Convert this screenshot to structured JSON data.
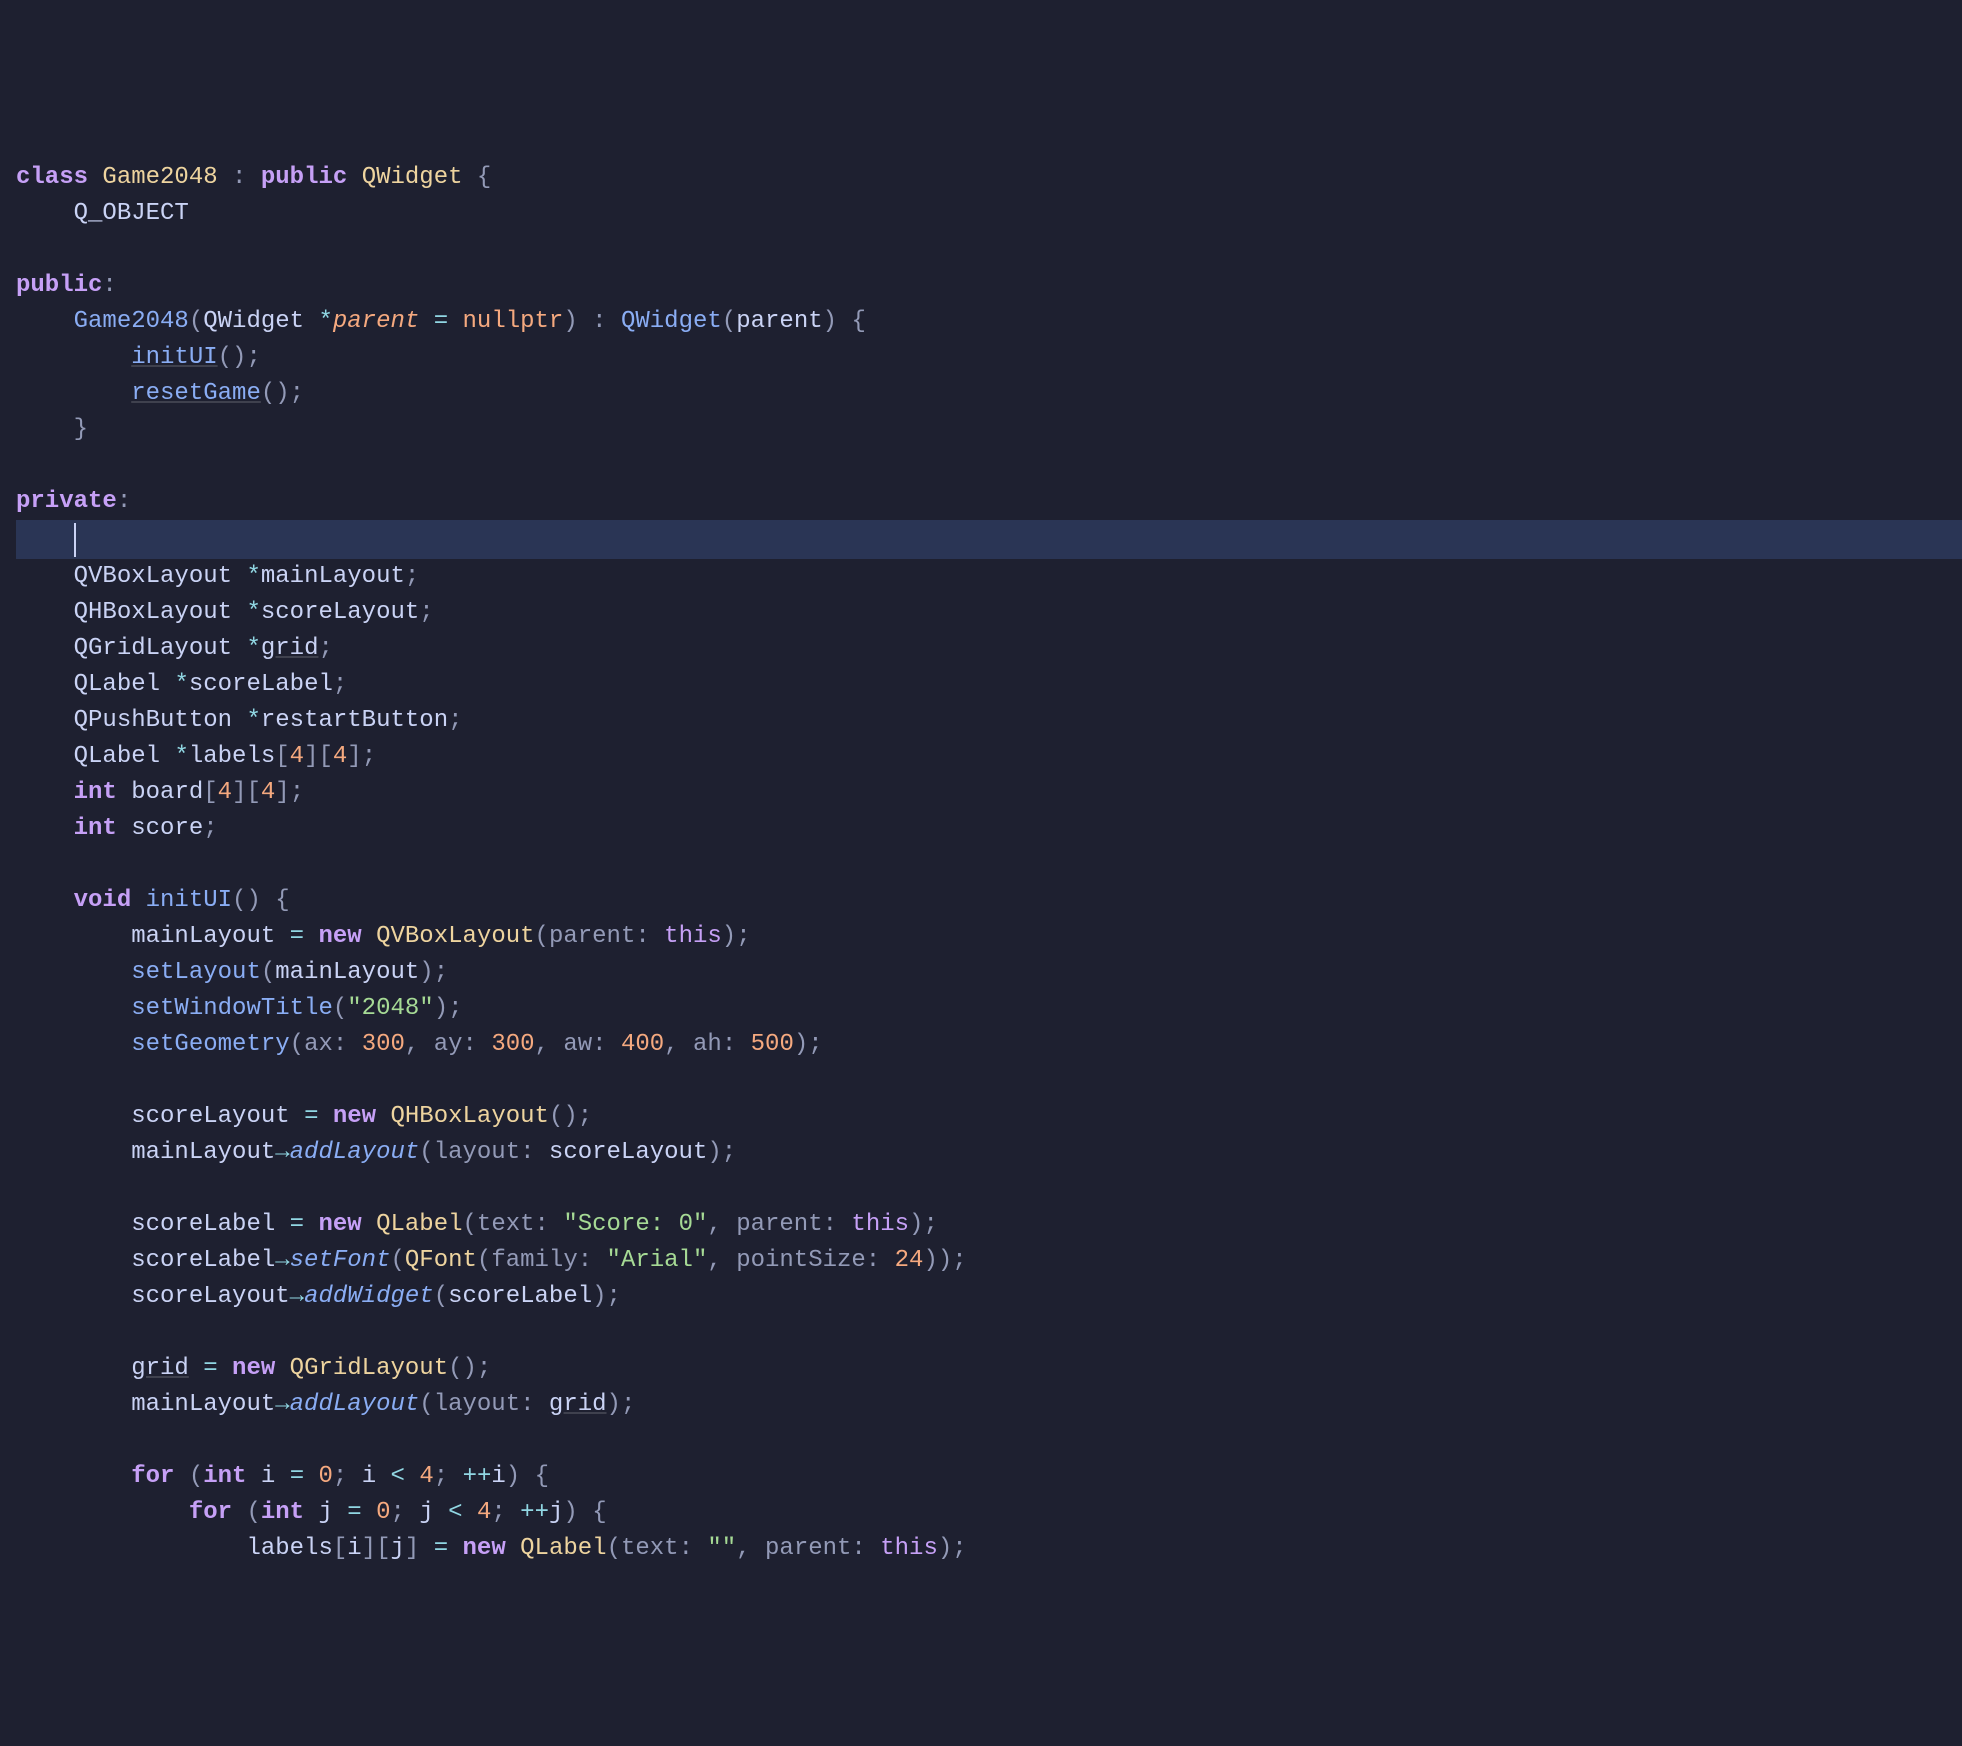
{
  "code": {
    "line1": {
      "kw_class": "class",
      "type_game": "Game2048",
      "colon": ":",
      "kw_public": "public",
      "type_qwidget": "QWidget",
      "brace": "{"
    },
    "line2": {
      "macro": "Q_OBJECT"
    },
    "line3": {
      "kw_public": "public",
      "colon": ":"
    },
    "line4": {
      "fn_game": "Game2048",
      "lparen": "(",
      "type_qwidget": "QWidget",
      "star": "*",
      "param_parent": "parent",
      "eq": "=",
      "kw_nullptr": "nullptr",
      "rparen": ")",
      "colon": ":",
      "fn_qwidget": "QWidget",
      "lparen2": "(",
      "var_parent": "parent",
      "rparen2": ")",
      "brace": "{"
    },
    "line5": {
      "fn_initui": "initUI",
      "parens": "()",
      "semi": ";"
    },
    "line6": {
      "fn_reset": "resetGame",
      "parens": "()",
      "semi": ";"
    },
    "line7": {
      "brace": "}"
    },
    "line8": {
      "kw_private": "private",
      "colon": ":"
    },
    "line10": {
      "type": "QVBoxLayout",
      "star": "*",
      "var": "mainLayout",
      "semi": ";"
    },
    "line11": {
      "type": "QHBoxLayout",
      "star": "*",
      "var": "scoreLayout",
      "semi": ";"
    },
    "line12": {
      "type": "QGridLayout",
      "star": "*",
      "var": "grid",
      "semi": ";"
    },
    "line13": {
      "type": "QLabel",
      "star": "*",
      "var": "scoreLabel",
      "semi": ";"
    },
    "line14": {
      "type": "QPushButton",
      "star": "*",
      "var": "restartButton",
      "semi": ";"
    },
    "line15": {
      "type": "QLabel",
      "star": "*",
      "var": "labels",
      "lb1": "[",
      "n1": "4",
      "rb1": "]",
      "lb2": "[",
      "n2": "4",
      "rb2": "]",
      "semi": ";"
    },
    "line16": {
      "kw_int": "int",
      "var": "board",
      "lb1": "[",
      "n1": "4",
      "rb1": "]",
      "lb2": "[",
      "n2": "4",
      "rb2": "]",
      "semi": ";"
    },
    "line17": {
      "kw_int": "int",
      "var": "score",
      "semi": ";"
    },
    "line18": {
      "kw_void": "void",
      "fn": "initUI",
      "parens": "()",
      "brace": "{"
    },
    "line19": {
      "var": "mainLayout",
      "eq": "=",
      "kw_new": "new",
      "type": "QVBoxLayout",
      "lparen": "(",
      "hint": "parent:",
      "kw_this": "this",
      "rparen": ")",
      "semi": ";"
    },
    "line20": {
      "fn": "setLayout",
      "lparen": "(",
      "var": "mainLayout",
      "rparen": ")",
      "semi": ";"
    },
    "line21": {
      "fn": "setWindowTitle",
      "lparen": "(",
      "str": "\"2048\"",
      "rparen": ")",
      "semi": ";"
    },
    "line22": {
      "fn": "setGeometry",
      "lparen": "(",
      "h1": "ax:",
      "n1": "300",
      "c1": ",",
      "h2": "ay:",
      "n2": "300",
      "c2": ",",
      "h3": "aw:",
      "n3": "400",
      "c3": ",",
      "h4": "ah:",
      "n4": "500",
      "rparen": ")",
      "semi": ";"
    },
    "line23": {
      "var": "scoreLayout",
      "eq": "=",
      "kw_new": "new",
      "type": "QHBoxLayout",
      "parens": "()",
      "semi": ";"
    },
    "line24": {
      "var": "mainLayout",
      "arrow": "→",
      "fn": "addLayout",
      "lparen": "(",
      "hint": "layout:",
      "var2": "scoreLayout",
      "rparen": ")",
      "semi": ";"
    },
    "line25": {
      "var": "scoreLabel",
      "eq": "=",
      "kw_new": "new",
      "type": "QLabel",
      "lparen": "(",
      "h1": "text:",
      "str": "\"Score: 0\"",
      "c1": ",",
      "h2": "parent:",
      "kw_this": "this",
      "rparen": ")",
      "semi": ";"
    },
    "line26": {
      "var": "scoreLabel",
      "arrow": "→",
      "fn": "setFont",
      "lparen": "(",
      "type": "QFont",
      "lparen2": "(",
      "h1": "family:",
      "str": "\"Arial\"",
      "c1": ",",
      "h2": "pointSize:",
      "n1": "24",
      "rparen2": ")",
      "rparen": ")",
      "semi": ";"
    },
    "line27": {
      "var": "scoreLayout",
      "arrow": "→",
      "fn": "addWidget",
      "lparen": "(",
      "var2": "scoreLabel",
      "rparen": ")",
      "semi": ";"
    },
    "line28": {
      "var": "grid",
      "eq": "=",
      "kw_new": "new",
      "type": "QGridLayout",
      "parens": "()",
      "semi": ";"
    },
    "line29": {
      "var": "mainLayout",
      "arrow": "→",
      "fn": "addLayout",
      "lparen": "(",
      "hint": "layout:",
      "var2": "grid",
      "rparen": ")",
      "semi": ";"
    },
    "line30": {
      "kw_for": "for",
      "lparen": "(",
      "kw_int": "int",
      "var_i": "i",
      "eq": "=",
      "n0": "0",
      "semi1": ";",
      "var_i2": "i",
      "lt": "<",
      "n4": "4",
      "semi2": ";",
      "inc": "++",
      "var_i3": "i",
      "rparen": ")",
      "brace": "{"
    },
    "line31": {
      "kw_for": "for",
      "lparen": "(",
      "kw_int": "int",
      "var_j": "j",
      "eq": "=",
      "n0": "0",
      "semi1": ";",
      "var_j2": "j",
      "lt": "<",
      "n4": "4",
      "semi2": ";",
      "inc": "++",
      "var_j3": "j",
      "rparen": ")",
      "brace": "{"
    },
    "line32": {
      "var": "labels",
      "lb1": "[",
      "var_i": "i",
      "rb1": "]",
      "lb2": "[",
      "var_j": "j",
      "rb2": "]",
      "eq": "=",
      "kw_new": "new",
      "type": "QLabel",
      "lparen": "(",
      "h1": "text:",
      "str": "\"\"",
      "c1": ",",
      "h2": "parent:",
      "kw_this": "this",
      "rparen": ")",
      "semi": ";"
    }
  }
}
